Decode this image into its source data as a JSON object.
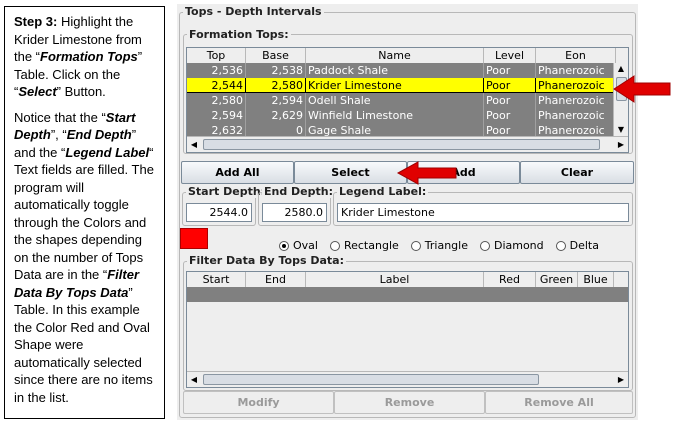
{
  "instructions": {
    "step_label": "Step 3:",
    "p1_a": "Highlight the Krider Limestone from the “",
    "p1_b": "Formation Tops",
    "p1_c": "” Table.  Click on the “",
    "p1_d": "Select",
    "p1_e": "” Button.",
    "p2_a": "Notice that the “",
    "p2_b": "Start Depth",
    "p2_c": "”, “",
    "p2_d": "End Depth",
    "p2_e": "” and the “",
    "p2_f": "Legend Label",
    "p2_g": "“ Text fields are filled. The program will automatically toggle through the Colors and the shapes depending on the number of Tops Data are in the “",
    "p2_h": "Filter Data By Tops Data",
    "p2_i": "” Table. In this example the Color Red  and Oval Shape were automatically selected since there are no items in the list."
  },
  "app": {
    "group_title": "Tops - Depth Intervals",
    "formation_tops": {
      "title": "Formation Tops:",
      "columns": [
        "Top",
        "Base",
        "Name",
        "Level",
        "Eon"
      ],
      "rows": [
        {
          "top": "2,536",
          "base": "2,538",
          "name": "Paddock Shale",
          "level": "Poor",
          "eon": "Phanerozoic"
        },
        {
          "top": "2,544",
          "base": "2,580",
          "name": "Krider Limestone",
          "level": "Poor",
          "eon": "Phanerozoic",
          "selected": true
        },
        {
          "top": "2,580",
          "base": "2,594",
          "name": "Odell Shale",
          "level": "Poor",
          "eon": "Phanerozoic"
        },
        {
          "top": "2,594",
          "base": "2,629",
          "name": "Winfield Limestone",
          "level": "Poor",
          "eon": "Phanerozoic"
        },
        {
          "top": "2,632",
          "base": "0",
          "name": "Gage Shale",
          "level": "Poor",
          "eon": "Phanerozoic"
        }
      ]
    },
    "buttons": {
      "add_all": "Add All",
      "select": "Select",
      "add": "Add",
      "clear": "Clear"
    },
    "start_depth": {
      "label": "Start Depth:",
      "value": "2544.0"
    },
    "end_depth": {
      "label": "End Depth:",
      "value": "2580.0"
    },
    "legend_label": {
      "label": "Legend Label:",
      "value": "Krider Limestone"
    },
    "color_swatch": "#ff0000",
    "shapes": [
      {
        "label": "Oval",
        "selected": true
      },
      {
        "label": "Rectangle",
        "selected": false
      },
      {
        "label": "Triangle",
        "selected": false
      },
      {
        "label": "Diamond",
        "selected": false
      },
      {
        "label": "Delta",
        "selected": false
      }
    ],
    "filter_table": {
      "title": "Filter Data By Tops Data:",
      "columns": [
        "Start",
        "End",
        "Label",
        "Red",
        "Green",
        "Blue"
      ]
    },
    "bottom_buttons": {
      "modify": "Modify",
      "remove": "Remove",
      "remove_all": "Remove All"
    }
  },
  "colors": {
    "highlight": "#ffff00",
    "row_bg": "#808080",
    "arrow": "#e00000"
  }
}
